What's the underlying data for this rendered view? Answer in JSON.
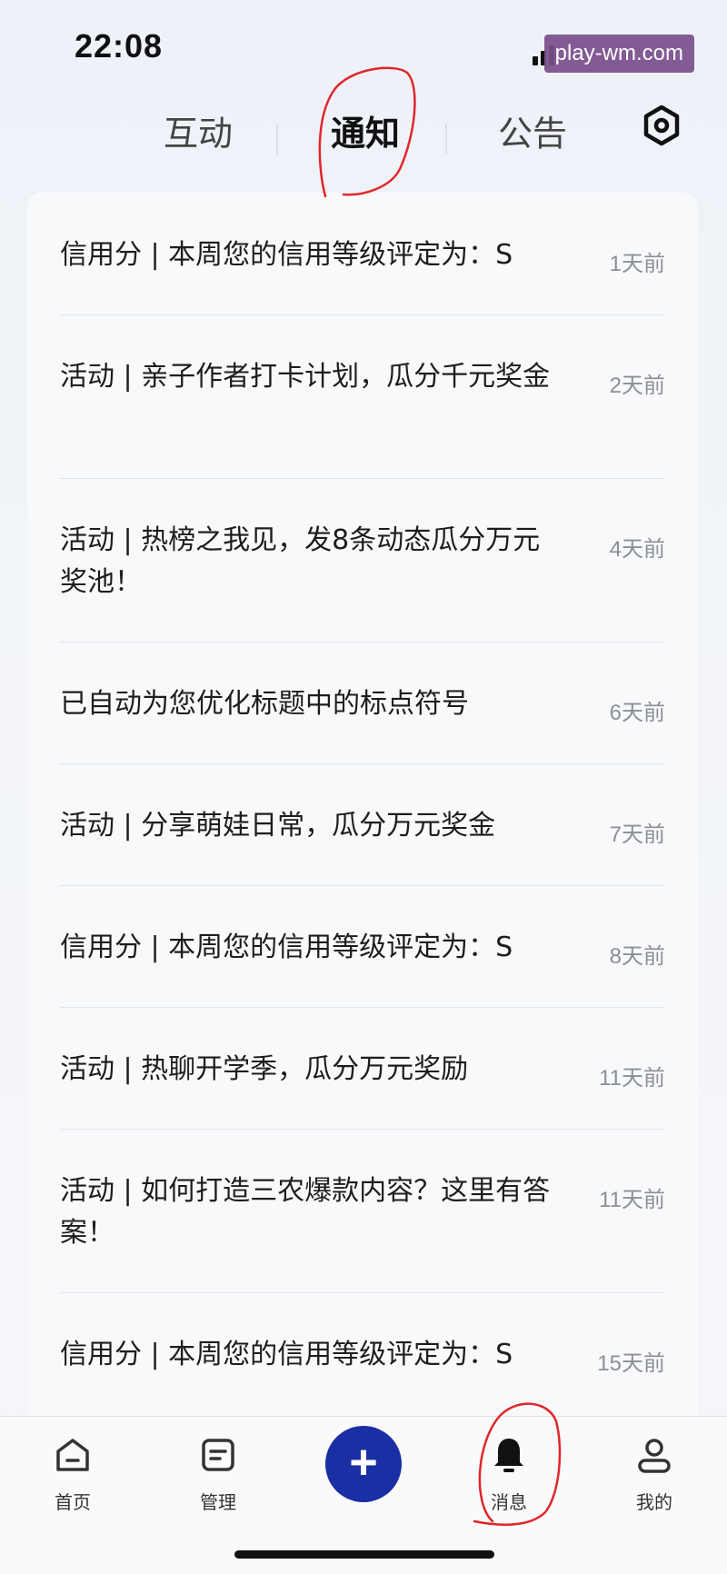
{
  "status": {
    "time": "22:08",
    "watermark": "play-wm.com"
  },
  "tabs": [
    {
      "label": "互动"
    },
    {
      "label": "通知",
      "active": true
    },
    {
      "label": "公告"
    }
  ],
  "notifications": [
    {
      "title": "信用分 | 本周您的信用等级评定为：S",
      "time": "1天前"
    },
    {
      "title": "活动 | 亲子作者打卡计划，瓜分千元奖金",
      "time": "2天前"
    },
    {
      "title": "活动 | 热榜之我见，发8条动态瓜分万元奖池！",
      "time": "4天前"
    },
    {
      "title": "已自动为您优化标题中的标点符号",
      "time": "6天前"
    },
    {
      "title": "活动 | 分享萌娃日常，瓜分万元奖金",
      "time": "7天前"
    },
    {
      "title": "信用分 | 本周您的信用等级评定为：S",
      "time": "8天前"
    },
    {
      "title": "活动 | 热聊开学季，瓜分万元奖励",
      "time": "11天前"
    },
    {
      "title": "活动 | 如何打造三农爆款内容？这里有答案！",
      "time": "11天前"
    },
    {
      "title": "信用分 | 本周您的信用等级评定为：S",
      "time": "15天前"
    }
  ],
  "tabbar": {
    "home": "首页",
    "manage": "管理",
    "plus": "+",
    "messages": "消息",
    "mine": "我的"
  },
  "colors": {
    "accent": "#1a2fa3",
    "annotation": "#e0262b"
  }
}
